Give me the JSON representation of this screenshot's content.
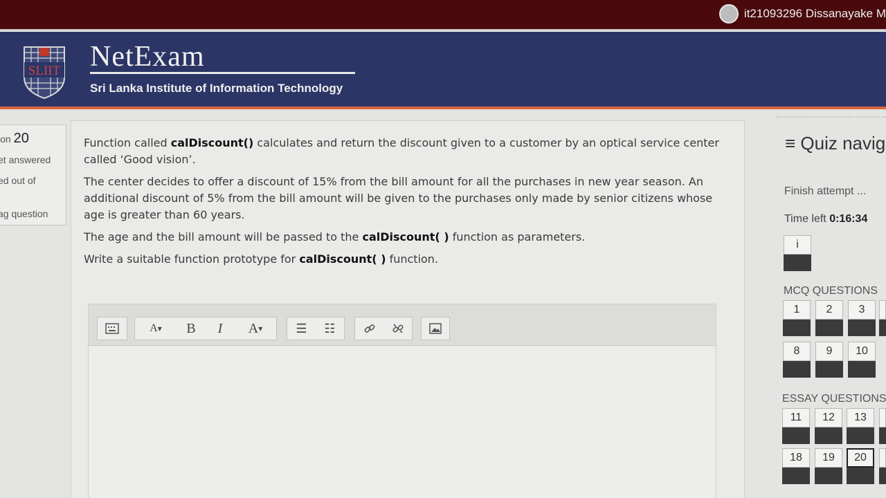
{
  "user": {
    "name": "it21093296 Dissanayake M"
  },
  "brand": {
    "logo_text": "SLIIT",
    "title": "NetExam",
    "subtitle": "Sri Lanka Institute of Information Technology"
  },
  "question_info": {
    "label": "ion",
    "number": "20",
    "status": "et answered",
    "marked": "ed out of",
    "flag": "ag question"
  },
  "question": {
    "para1_a": "Function called ",
    "para1_fn": "calDiscount()",
    "para1_b": " calculates and return the discount given to a customer by an optical service center called ‘Good vision’.",
    "para2": "The center decides to offer a discount of 15% from the bill amount for all the purchases in new year season. An additional discount of 5% from the bill amount will be given to the purchases only made by senior citizens whose age is greater than 60 years.",
    "para3_a": "The age and the bill amount will be passed to the ",
    "para3_fn": "calDiscount( )",
    "para3_b": " function as parameters.",
    "para4_a": "Write a suitable function prototype for ",
    "para4_fn": "calDiscount( )",
    "para4_b": " function."
  },
  "editor": {
    "font_btn": "A",
    "bold_btn": "B",
    "italic_btn": "I",
    "color_btn": "A",
    "answer": ""
  },
  "nav": {
    "title": "Quiz navig",
    "finish": "Finish attempt ...",
    "time_label": "Time left ",
    "time_value": "0:16:34",
    "info_btn": "i",
    "mcq_heading": "MCQ QUESTIONS",
    "mcq": [
      "1",
      "2",
      "3",
      "8",
      "9",
      "10"
    ],
    "essay_heading": "ESSAY QUESTIONS",
    "essay": [
      "11",
      "12",
      "13",
      "18",
      "19",
      "20"
    ],
    "current": "20"
  }
}
